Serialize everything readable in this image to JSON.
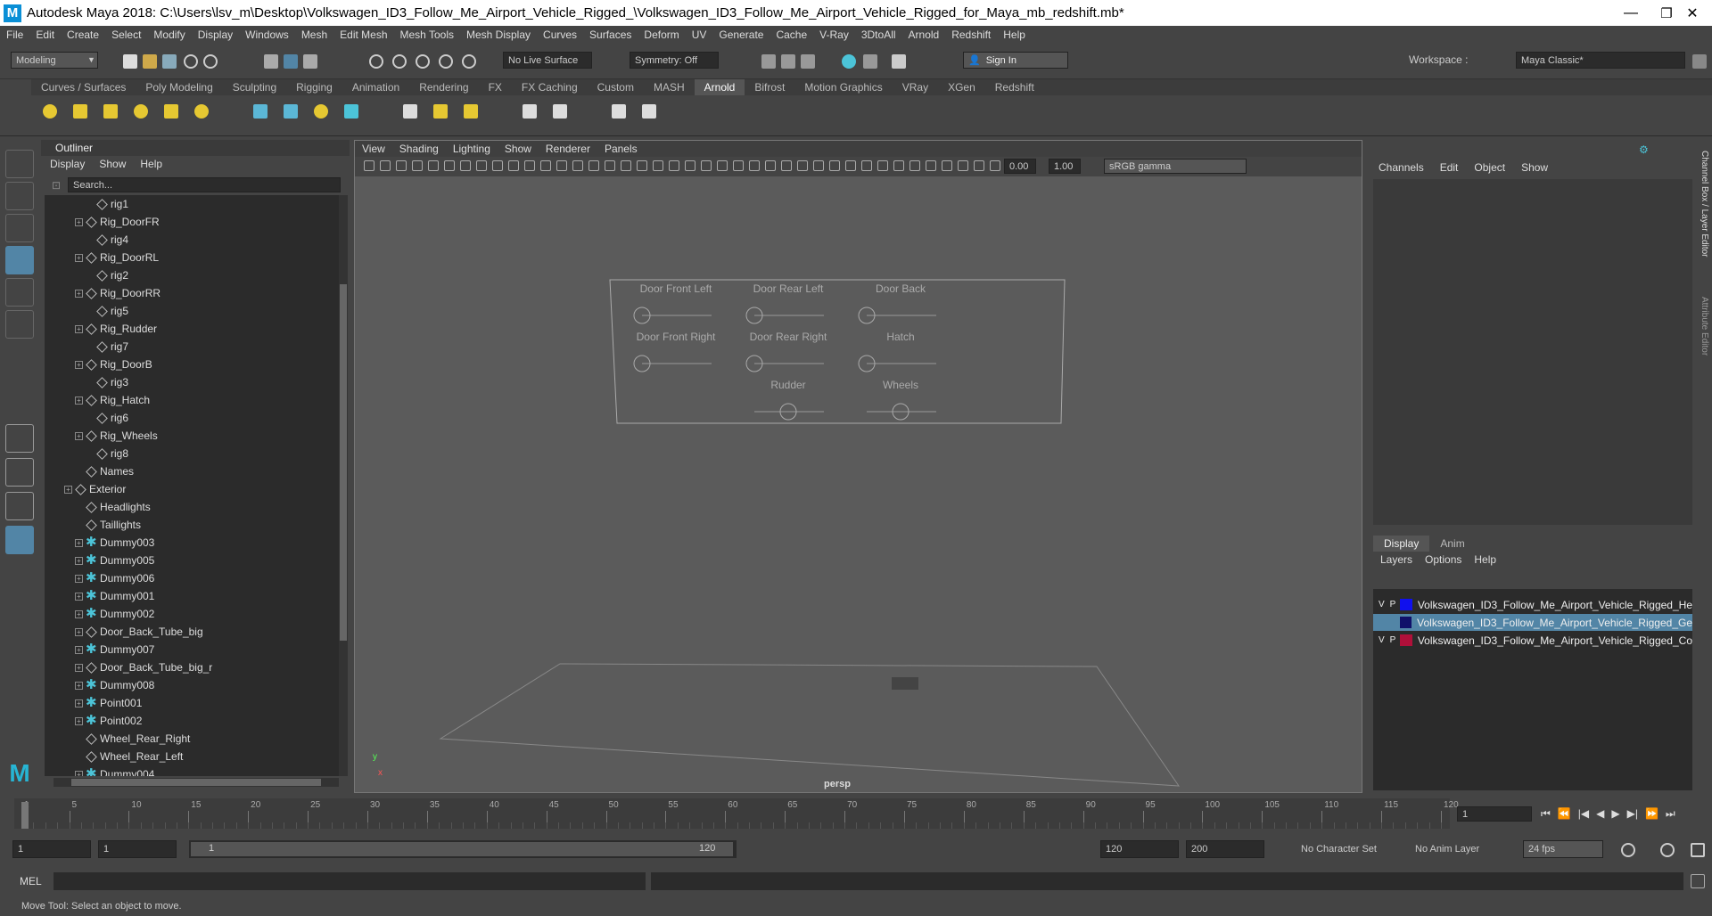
{
  "window": {
    "title": "Autodesk Maya 2018: C:\\Users\\lsv_m\\Desktop\\Volkswagen_ID3_Follow_Me_Airport_Vehicle_Rigged_\\Volkswagen_ID3_Follow_Me_Airport_Vehicle_Rigged_for_Maya_mb_redshift.mb*",
    "logo": "M",
    "minimize": "—",
    "restore": "❐",
    "close": "✕"
  },
  "menu": [
    "File",
    "Edit",
    "Create",
    "Select",
    "Modify",
    "Display",
    "Windows",
    "Mesh",
    "Edit Mesh",
    "Mesh Tools",
    "Mesh Display",
    "Curves",
    "Surfaces",
    "Deform",
    "UV",
    "Generate",
    "Cache",
    "V-Ray",
    "3DtoAll",
    "Arnold",
    "Redshift",
    "Help"
  ],
  "status": {
    "mode": "Modeling",
    "live_surface": "No Live Surface",
    "symmetry": "Symmetry: Off",
    "sign_in": "Sign In",
    "workspace_label": "Workspace :",
    "workspace": "Maya Classic*"
  },
  "shelf_tabs": [
    "Curves / Surfaces",
    "Poly Modeling",
    "Sculpting",
    "Rigging",
    "Animation",
    "Rendering",
    "FX",
    "FX Caching",
    "Custom",
    "MASH",
    "Arnold",
    "Bifrost",
    "Motion Graphics",
    "VRay",
    "XGen",
    "Redshift"
  ],
  "active_shelf": "Arnold",
  "outliner": {
    "title": "Outliner",
    "menu": [
      "Display",
      "Show",
      "Help"
    ],
    "search_placeholder": "Search...",
    "rows": [
      {
        "name": "rig1",
        "indent": 3,
        "icon": "group",
        "exp": false
      },
      {
        "name": "Rig_DoorFR",
        "indent": 2,
        "icon": "group",
        "exp": true
      },
      {
        "name": "rig4",
        "indent": 3,
        "icon": "group",
        "exp": false
      },
      {
        "name": "Rig_DoorRL",
        "indent": 2,
        "icon": "group",
        "exp": true
      },
      {
        "name": "rig2",
        "indent": 3,
        "icon": "group",
        "exp": false
      },
      {
        "name": "Rig_DoorRR",
        "indent": 2,
        "icon": "group",
        "exp": true
      },
      {
        "name": "rig5",
        "indent": 3,
        "icon": "group",
        "exp": false
      },
      {
        "name": "Rig_Rudder",
        "indent": 2,
        "icon": "group",
        "exp": true
      },
      {
        "name": "rig7",
        "indent": 3,
        "icon": "group",
        "exp": false
      },
      {
        "name": "Rig_DoorB",
        "indent": 2,
        "icon": "group",
        "exp": true
      },
      {
        "name": "rig3",
        "indent": 3,
        "icon": "group",
        "exp": false
      },
      {
        "name": "Rig_Hatch",
        "indent": 2,
        "icon": "group",
        "exp": true
      },
      {
        "name": "rig6",
        "indent": 3,
        "icon": "group",
        "exp": false
      },
      {
        "name": "Rig_Wheels",
        "indent": 2,
        "icon": "group",
        "exp": true
      },
      {
        "name": "rig8",
        "indent": 3,
        "icon": "group",
        "exp": false
      },
      {
        "name": "Names",
        "indent": 2,
        "icon": "group",
        "exp": false
      },
      {
        "name": "Exterior",
        "indent": 1,
        "icon": "group",
        "exp": true
      },
      {
        "name": "Headlights",
        "indent": 2,
        "icon": "group",
        "exp": false
      },
      {
        "name": "Taillights",
        "indent": 2,
        "icon": "group",
        "exp": false
      },
      {
        "name": "Dummy003",
        "indent": 2,
        "icon": "joint",
        "exp": true
      },
      {
        "name": "Dummy005",
        "indent": 2,
        "icon": "joint",
        "exp": true
      },
      {
        "name": "Dummy006",
        "indent": 2,
        "icon": "joint",
        "exp": true
      },
      {
        "name": "Dummy001",
        "indent": 2,
        "icon": "joint",
        "exp": true
      },
      {
        "name": "Dummy002",
        "indent": 2,
        "icon": "joint",
        "exp": true
      },
      {
        "name": "Door_Back_Tube_big",
        "indent": 2,
        "icon": "group",
        "exp": true
      },
      {
        "name": "Dummy007",
        "indent": 2,
        "icon": "joint",
        "exp": true
      },
      {
        "name": "Door_Back_Tube_big_r",
        "indent": 2,
        "icon": "group",
        "exp": true
      },
      {
        "name": "Dummy008",
        "indent": 2,
        "icon": "joint",
        "exp": true
      },
      {
        "name": "Point001",
        "indent": 2,
        "icon": "joint",
        "exp": true
      },
      {
        "name": "Point002",
        "indent": 2,
        "icon": "joint",
        "exp": true
      },
      {
        "name": "Wheel_Rear_Right",
        "indent": 2,
        "icon": "group",
        "exp": false
      },
      {
        "name": "Wheel_Rear_Left",
        "indent": 2,
        "icon": "group",
        "exp": false
      },
      {
        "name": "Dummy004",
        "indent": 2,
        "icon": "joint",
        "exp": true
      }
    ]
  },
  "viewport": {
    "menu": [
      "View",
      "Shading",
      "Lighting",
      "Show",
      "Renderer",
      "Panels"
    ],
    "exposure": "0.00",
    "gamma": "1.00",
    "color_space": "sRGB gamma",
    "camera": "persp",
    "axis_y": "y",
    "axis_x": "x",
    "controls": [
      "Door Front Left",
      "Door Rear Left",
      "Door Back",
      "Door Front Right",
      "Door Rear Right",
      "Hatch",
      "Rudder",
      "Wheels"
    ]
  },
  "channel_box": {
    "menu": [
      "Channels",
      "Edit",
      "Object",
      "Show"
    ],
    "side_tabs": [
      "Channel Box / Layer Editor",
      "Attribute Editor"
    ]
  },
  "layer_editor": {
    "tabs": [
      "Display",
      "Anim"
    ],
    "menu": [
      "Layers",
      "Options",
      "Help"
    ],
    "layers": [
      {
        "v": "V",
        "p": "P",
        "name": "Volkswagen_ID3_Follow_Me_Airport_Vehicle_Rigged_He",
        "color": "#1010ee",
        "selected": false
      },
      {
        "v": "",
        "p": "",
        "name": "Volkswagen_ID3_Follow_Me_Airport_Vehicle_Rigged_Ge",
        "color": "#10106a",
        "selected": true
      },
      {
        "v": "V",
        "p": "P",
        "name": "Volkswagen_ID3_Follow_Me_Airport_Vehicle_Rigged_Co",
        "color": "#b0103a",
        "selected": false
      }
    ]
  },
  "time": {
    "ticks": [
      "1",
      "5",
      "10",
      "15",
      "20",
      "25",
      "30",
      "35",
      "40",
      "45",
      "50",
      "55",
      "60",
      "65",
      "70",
      "75",
      "80",
      "85",
      "90",
      "95",
      "100",
      "105",
      "110",
      "115",
      "120"
    ],
    "current": "1",
    "start": "1",
    "range_start": "1",
    "range_slider_start": "1",
    "range_slider_end": "120",
    "range_end": "120",
    "end": "200",
    "character_set": "No Character Set",
    "anim_layer": "No Anim Layer",
    "fps": "24 fps"
  },
  "command": {
    "label": "MEL"
  },
  "help": {
    "text": "Move Tool: Select an object to move."
  }
}
